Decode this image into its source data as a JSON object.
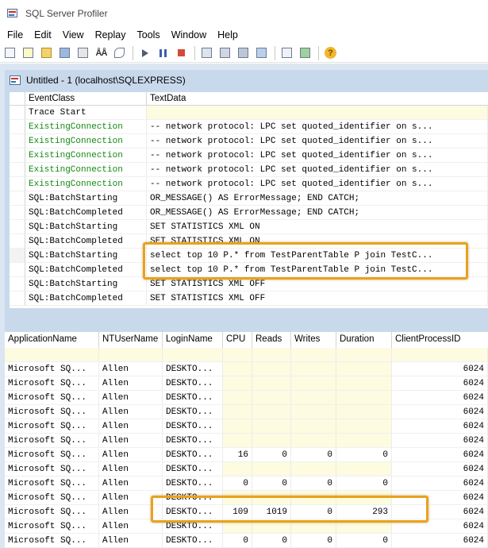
{
  "window": {
    "title": "SQL Server Profiler",
    "icon": "profiler-app-icon"
  },
  "menu": [
    "File",
    "Edit",
    "View",
    "Replay",
    "Tools",
    "Window",
    "Help"
  ],
  "toolbar": {
    "icons": [
      "new-trace-icon",
      "new-template-icon",
      "open-icon",
      "save-icon",
      "print-icon",
      "find-icon",
      "clear-icon",
      "run-icon",
      "pause-icon",
      "stop-icon",
      "properties-icon",
      "extract-icon",
      "templates-icon",
      "autoscroll-icon",
      "perfmon-import-icon",
      "sql-import-icon",
      "help-icon"
    ]
  },
  "trace_window": {
    "title": "Untitled - 1 (localhost\\SQLEXPRESS)",
    "columns": [
      "EventClass",
      "TextData"
    ],
    "rows": [
      {
        "event": "Trace Start",
        "text": "",
        "green": false
      },
      {
        "event": "ExistingConnection",
        "text": "-- network protocol: LPC  set quoted_identifier on  s...",
        "green": true
      },
      {
        "event": "ExistingConnection",
        "text": "-- network protocol: LPC  set quoted_identifier on  s...",
        "green": true
      },
      {
        "event": "ExistingConnection",
        "text": "-- network protocol: LPC  set quoted_identifier on  s...",
        "green": true
      },
      {
        "event": "ExistingConnection",
        "text": "-- network protocol: LPC  set quoted_identifier on  s...",
        "green": true
      },
      {
        "event": "ExistingConnection",
        "text": "-- network protocol: LPC  set quoted_identifier on  s...",
        "green": true
      },
      {
        "event": "SQL:BatchStarting",
        "text": "OR_MESSAGE() AS ErrorMessage;  END CATCH;",
        "green": false
      },
      {
        "event": "SQL:BatchCompleted",
        "text": "OR_MESSAGE() AS ErrorMessage;  END CATCH;",
        "green": false
      },
      {
        "event": "SQL:BatchStarting",
        "text": "SET STATISTICS XML ON",
        "green": false
      },
      {
        "event": "SQL:BatchCompleted",
        "text": "SET STATISTICS XML ON",
        "green": false
      },
      {
        "event": "SQL:BatchStarting",
        "text": "select top 10 P.*  from TestParentTable P  join TestC...",
        "green": false
      },
      {
        "event": "SQL:BatchCompleted",
        "text": "select top 10 P.*  from TestParentTable P  join TestC...",
        "green": false
      },
      {
        "event": "SQL:BatchStarting",
        "text": "SET STATISTICS XML OFF",
        "green": false
      },
      {
        "event": "SQL:BatchCompleted",
        "text": "SET STATISTICS XML OFF",
        "green": false
      }
    ]
  },
  "details_grid": {
    "columns": [
      "ApplicationName",
      "NTUserName",
      "LoginName",
      "CPU",
      "Reads",
      "Writes",
      "Duration",
      "ClientProcessID"
    ],
    "rows": [
      [
        "",
        "",
        "",
        "",
        "",
        "",
        "",
        ""
      ],
      [
        "Microsoft SQ...",
        "Allen",
        "DESKTO...",
        "",
        "",
        "",
        "",
        "6024"
      ],
      [
        "Microsoft SQ...",
        "Allen",
        "DESKTO...",
        "",
        "",
        "",
        "",
        "6024"
      ],
      [
        "Microsoft SQ...",
        "Allen",
        "DESKTO...",
        "",
        "",
        "",
        "",
        "6024"
      ],
      [
        "Microsoft SQ...",
        "Allen",
        "DESKTO...",
        "",
        "",
        "",
        "",
        "6024"
      ],
      [
        "Microsoft SQ...",
        "Allen",
        "DESKTO...",
        "",
        "",
        "",
        "",
        "6024"
      ],
      [
        "Microsoft SQ...",
        "Allen",
        "DESKTO...",
        "",
        "",
        "",
        "",
        "6024"
      ],
      [
        "Microsoft SQ...",
        "Allen",
        "DESKTO...",
        "16",
        "0",
        "0",
        "0",
        "6024"
      ],
      [
        "Microsoft SQ...",
        "Allen",
        "DESKTO...",
        "",
        "",
        "",
        "",
        "6024"
      ],
      [
        "Microsoft SQ...",
        "Allen",
        "DESKTO...",
        "0",
        "0",
        "0",
        "0",
        "6024"
      ],
      [
        "Microsoft SQ...",
        "Allen",
        "DESKTO...",
        "",
        "",
        "",
        "",
        "6024"
      ],
      [
        "Microsoft SQ...",
        "Allen",
        "DESKTO...",
        "109",
        "1019",
        "0",
        "293",
        "6024"
      ],
      [
        "Microsoft SQ...",
        "Allen",
        "DESKTO...",
        "",
        "",
        "",
        "",
        "6024"
      ],
      [
        "Microsoft SQ...",
        "Allen",
        "DESKTO...",
        "0",
        "0",
        "0",
        "0",
        "6024"
      ]
    ]
  },
  "colors": {
    "highlight": "#e8a21c",
    "existing_connection": "#128a12",
    "frame": "#c9d9ec"
  }
}
